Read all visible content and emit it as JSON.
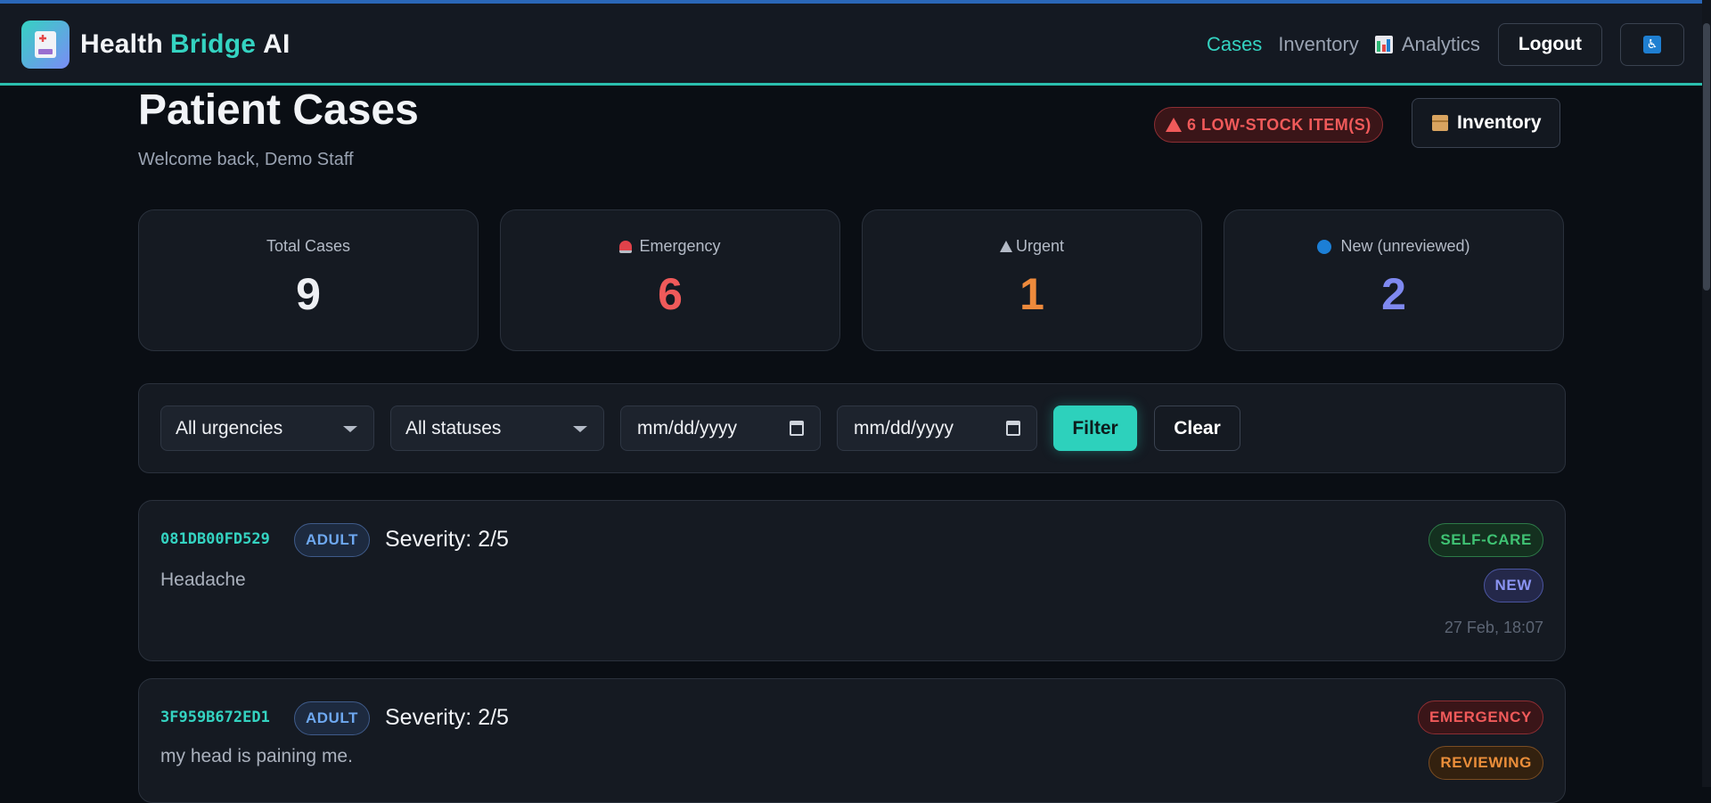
{
  "app": {
    "brand_parts": [
      "Health",
      "Bridge",
      "AI"
    ],
    "nav": {
      "cases": "Cases",
      "inventory": "Inventory",
      "analytics": "Analytics",
      "logout": "Logout"
    }
  },
  "header": {
    "title": "Patient Cases",
    "welcome": "Welcome back, Demo Staff",
    "low_stock": "6 LOW-STOCK ITEM(S)",
    "inventory_button": "Inventory"
  },
  "stats": [
    {
      "label": "Total Cases",
      "value": "9",
      "color": "#eef0f4"
    },
    {
      "label": "Emergency",
      "value": "6",
      "color": "#f05a5a"
    },
    {
      "label": "Urgent",
      "value": "1",
      "color": "#ee8a3c"
    },
    {
      "label": "New (unreviewed)",
      "value": "2",
      "color": "#7f89f0"
    }
  ],
  "filters": {
    "urgency": "All urgencies",
    "status": "All statuses",
    "date_from": "mm/dd/yyyy",
    "date_to": "mm/dd/yyyy",
    "filter_button": "Filter",
    "clear_button": "Clear"
  },
  "cases": [
    {
      "id": "081DB00FD529",
      "age_group": "ADULT",
      "severity": "Severity: 2/5",
      "complaint": "Headache",
      "urgency": "SELF-CARE",
      "status": "NEW",
      "time": "27 Feb, 18:07"
    },
    {
      "id": "3F959B672ED1",
      "age_group": "ADULT",
      "severity": "Severity: 2/5",
      "complaint": "my head is paining me.",
      "urgency": "EMERGENCY",
      "status": "REVIEWING"
    }
  ]
}
